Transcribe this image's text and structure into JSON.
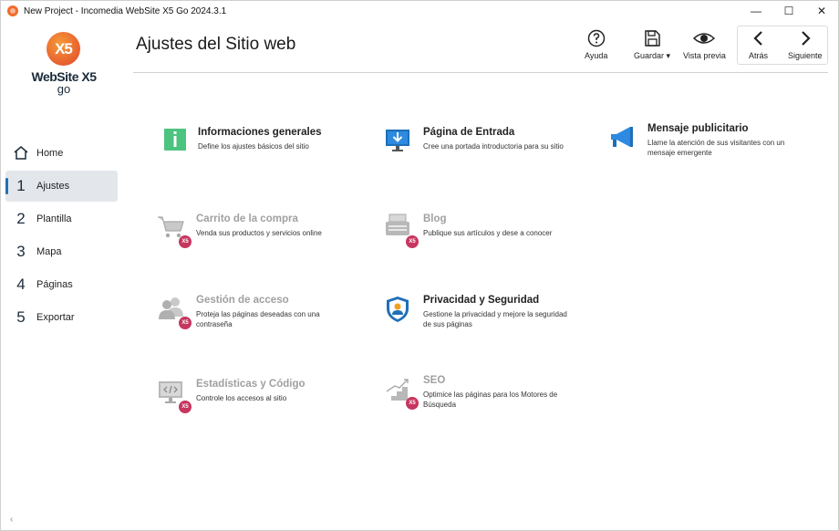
{
  "window": {
    "title": "New Project - Incomedia WebSite X5 Go 2024.3.1",
    "controls": {
      "minimize": "—",
      "maximize": "☐",
      "close": "✕"
    }
  },
  "logo": {
    "mark": "X5",
    "name": "WebSite X5",
    "edition": "go"
  },
  "sidebar": {
    "items": [
      {
        "num": "",
        "label": "Home",
        "icon": "home-icon"
      },
      {
        "num": "1",
        "label": "Ajustes",
        "active": true
      },
      {
        "num": "2",
        "label": "Plantilla"
      },
      {
        "num": "3",
        "label": "Mapa"
      },
      {
        "num": "4",
        "label": "Páginas"
      },
      {
        "num": "5",
        "label": "Exportar"
      }
    ],
    "collapse": "‹"
  },
  "header": {
    "title": "Ajustes del Sitio web",
    "tools": {
      "help": "Ayuda",
      "save": "Guardar ▾",
      "preview": "Vista previa",
      "back": "Atrás",
      "next": "Siguiente"
    }
  },
  "settings": {
    "general": {
      "name": "Informaciones generales",
      "desc": "Define los ajustes básicos del sitio",
      "icon": "info-icon"
    },
    "entry": {
      "name": "Página de Entrada",
      "desc": "Cree una portada introductoria para su sitio",
      "icon": "monitor-download-icon"
    },
    "ad": {
      "name": "Mensaje publicitario",
      "desc1": "Llame la atención de sus visitantes con un",
      "desc2": "mensaje emergente",
      "icon": "megaphone-icon"
    },
    "cart": {
      "name": "Carrito de la compra",
      "desc": "Venda sus productos y servicios online",
      "icon": "shopping-cart-icon",
      "badge": "X5"
    },
    "blog": {
      "name": "Blog",
      "desc": "Publique sus artículos y dese a conocer",
      "icon": "typewriter-icon",
      "badge": "X5"
    },
    "access": {
      "name": "Gestión de acceso",
      "desc1": "Proteja las páginas deseadas con una",
      "desc2": "contraseña",
      "icon": "users-icon",
      "badge": "X5"
    },
    "privacy": {
      "name": "Privacidad y Seguridad",
      "desc1": "Gestione la privacidad y mejore la seguridad",
      "desc2": "de sus páginas",
      "icon": "shield-user-icon"
    },
    "stats": {
      "name": "Estadísticas y Código",
      "desc": "Controle los accesos al sitio",
      "icon": "code-monitor-icon",
      "badge": "X5"
    },
    "seo": {
      "name": "SEO",
      "desc1": "Optimice las páginas para los Motores de",
      "desc2": "Búsqueda",
      "icon": "stairs-chart-icon",
      "badge": "X5"
    }
  },
  "colors": {
    "accent": "#1f6fb8",
    "badge": "#c7365f",
    "disabled_text": "#a0a0a0",
    "logo": "#e2452c"
  }
}
